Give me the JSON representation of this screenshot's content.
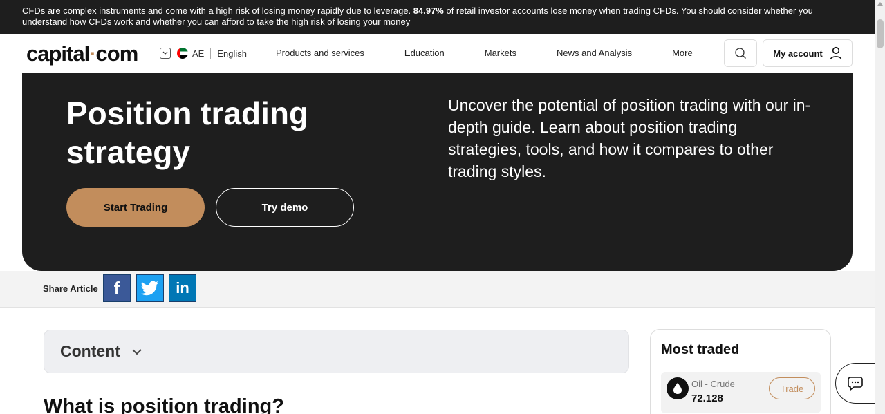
{
  "banner": {
    "pre": "CFDs are complex instruments and come with a high risk of losing money rapidly due to leverage. ",
    "percent": "84.97%",
    "post": " of retail investor accounts lose money when trading CFDs. You should consider whether you understand how CFDs work and whether you can afford to take the high risk of losing your money"
  },
  "header": {
    "logo_left": "capital",
    "logo_dot": "·",
    "logo_right": "com",
    "region_code": "AE",
    "language": "English",
    "nav": [
      "Products and services",
      "Education",
      "Markets",
      "News and Analysis",
      "More"
    ],
    "account_label": "My account"
  },
  "hero": {
    "title": "Position trading strategy",
    "description": "Uncover the potential of position trading with our in-depth guide. Learn about position trading strategies, tools, and how it compares to other trading styles.",
    "start_label": "Start Trading",
    "demo_label": "Try demo"
  },
  "share": {
    "label": "Share Article",
    "facebook_glyph": "f",
    "linkedin_glyph": "in"
  },
  "content": {
    "toggle_label": "Content",
    "article_heading": "What is position trading?"
  },
  "most_traded": {
    "title": "Most traded",
    "items": [
      {
        "name": "Oil - Crude",
        "price": "72.128",
        "action": "Trade"
      }
    ]
  },
  "colors": {
    "accent": "#c28d5c",
    "dark": "#1e1e1e",
    "facebook": "#3b5998",
    "twitter": "#1da1f2",
    "linkedin": "#0077b5"
  }
}
